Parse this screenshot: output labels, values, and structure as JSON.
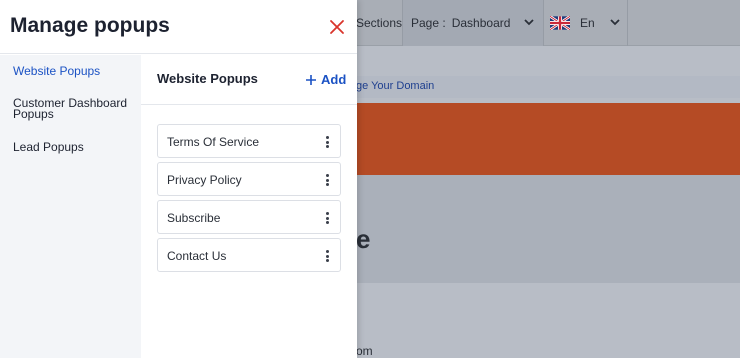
{
  "background": {
    "sections_label": "Sections",
    "page_select": {
      "label": "Page :",
      "value": "Dashboard"
    },
    "language": {
      "value": "En",
      "flag_icon": "uk-flag-icon"
    },
    "domain_link": "ge Your Domain",
    "hero_fragment": "e",
    "bottom_fragment": "om",
    "banner_color": "#b54b25"
  },
  "modal": {
    "title": "Manage popups",
    "close_icon": "close-icon",
    "nav": [
      {
        "label": "Website Popups",
        "active": true
      },
      {
        "label": "Customer Dashboard Popups",
        "active": false
      },
      {
        "label": "Lead Popups",
        "active": false
      }
    ],
    "content": {
      "title": "Website Popups",
      "add_label": "Add",
      "popups": [
        {
          "name": "Terms Of Service"
        },
        {
          "name": "Privacy Policy"
        },
        {
          "name": "Subscribe"
        },
        {
          "name": "Contact Us"
        }
      ]
    },
    "accent_color": "#1b52c4",
    "close_color": "#d9342b"
  }
}
